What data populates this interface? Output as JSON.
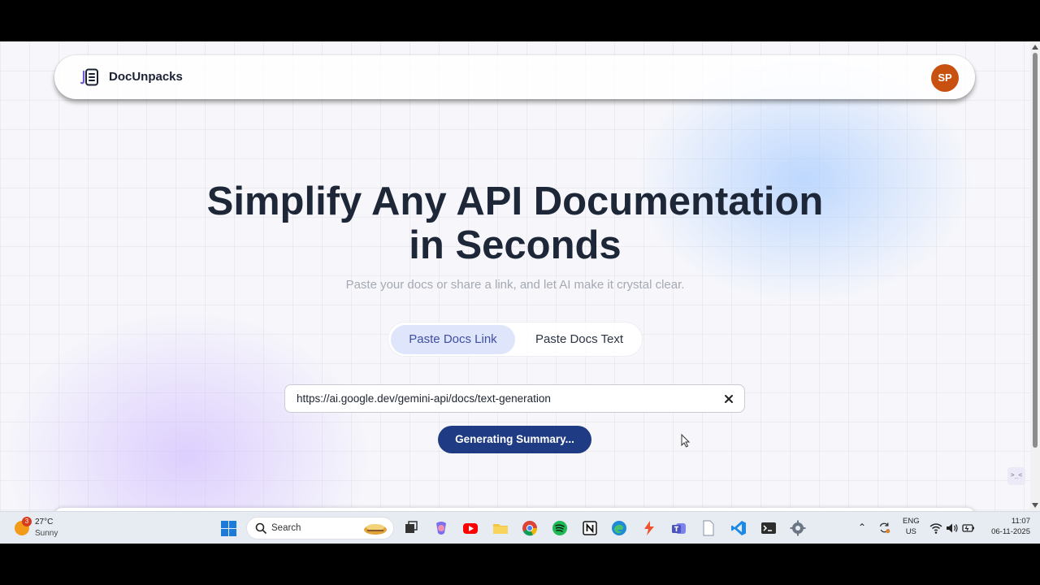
{
  "app": {
    "brand": "DocUnpacks",
    "avatar_initials": "SP",
    "avatar_color": "#c8510f",
    "accent_color": "#1f3b83"
  },
  "hero": {
    "title_line1": "Simplify Any API Documentation",
    "title_line2": "in Seconds",
    "subtitle": "Paste your docs or share a link, and let AI make it crystal clear."
  },
  "tabs": [
    {
      "label": "Paste Docs Link",
      "active": true
    },
    {
      "label": "Paste Docs Text",
      "active": false
    }
  ],
  "url_input": {
    "value": "https://ai.google.dev/gemini-api/docs/text-generation",
    "clear_icon": "close-icon"
  },
  "generate_button": {
    "label": "Generating Summary..."
  },
  "floating_button": {
    "label": ">_<"
  },
  "taskbar": {
    "weather": {
      "temperature": "27°C",
      "condition": "Sunny",
      "badge": "3"
    },
    "search_placeholder": "Search",
    "apps": [
      "task-view",
      "copilot",
      "youtube",
      "file-explorer",
      "chrome",
      "spotify",
      "notion",
      "edge",
      "todoist",
      "teams",
      "notepad",
      "vscode",
      "terminal",
      "settings"
    ],
    "language": {
      "line1": "ENG",
      "line2": "US"
    },
    "time": "11:07",
    "date": "06-11-2025"
  }
}
